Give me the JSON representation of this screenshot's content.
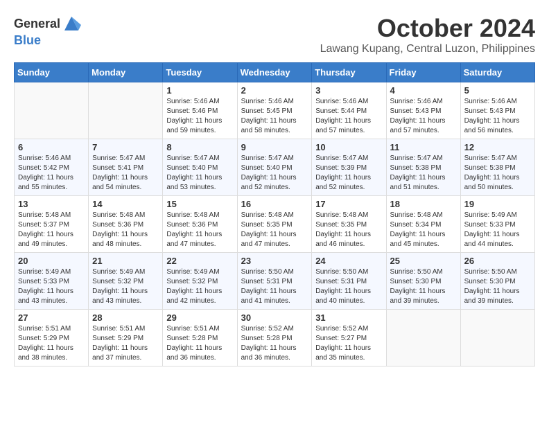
{
  "header": {
    "logo_general": "General",
    "logo_blue": "Blue",
    "month_title": "October 2024",
    "location": "Lawang Kupang, Central Luzon, Philippines"
  },
  "days_of_week": [
    "Sunday",
    "Monday",
    "Tuesday",
    "Wednesday",
    "Thursday",
    "Friday",
    "Saturday"
  ],
  "weeks": [
    [
      {
        "day": "",
        "info": ""
      },
      {
        "day": "",
        "info": ""
      },
      {
        "day": "1",
        "info": "Sunrise: 5:46 AM\nSunset: 5:46 PM\nDaylight: 11 hours and 59 minutes."
      },
      {
        "day": "2",
        "info": "Sunrise: 5:46 AM\nSunset: 5:45 PM\nDaylight: 11 hours and 58 minutes."
      },
      {
        "day": "3",
        "info": "Sunrise: 5:46 AM\nSunset: 5:44 PM\nDaylight: 11 hours and 57 minutes."
      },
      {
        "day": "4",
        "info": "Sunrise: 5:46 AM\nSunset: 5:43 PM\nDaylight: 11 hours and 57 minutes."
      },
      {
        "day": "5",
        "info": "Sunrise: 5:46 AM\nSunset: 5:43 PM\nDaylight: 11 hours and 56 minutes."
      }
    ],
    [
      {
        "day": "6",
        "info": "Sunrise: 5:46 AM\nSunset: 5:42 PM\nDaylight: 11 hours and 55 minutes."
      },
      {
        "day": "7",
        "info": "Sunrise: 5:47 AM\nSunset: 5:41 PM\nDaylight: 11 hours and 54 minutes."
      },
      {
        "day": "8",
        "info": "Sunrise: 5:47 AM\nSunset: 5:40 PM\nDaylight: 11 hours and 53 minutes."
      },
      {
        "day": "9",
        "info": "Sunrise: 5:47 AM\nSunset: 5:40 PM\nDaylight: 11 hours and 52 minutes."
      },
      {
        "day": "10",
        "info": "Sunrise: 5:47 AM\nSunset: 5:39 PM\nDaylight: 11 hours and 52 minutes."
      },
      {
        "day": "11",
        "info": "Sunrise: 5:47 AM\nSunset: 5:38 PM\nDaylight: 11 hours and 51 minutes."
      },
      {
        "day": "12",
        "info": "Sunrise: 5:47 AM\nSunset: 5:38 PM\nDaylight: 11 hours and 50 minutes."
      }
    ],
    [
      {
        "day": "13",
        "info": "Sunrise: 5:48 AM\nSunset: 5:37 PM\nDaylight: 11 hours and 49 minutes."
      },
      {
        "day": "14",
        "info": "Sunrise: 5:48 AM\nSunset: 5:36 PM\nDaylight: 11 hours and 48 minutes."
      },
      {
        "day": "15",
        "info": "Sunrise: 5:48 AM\nSunset: 5:36 PM\nDaylight: 11 hours and 47 minutes."
      },
      {
        "day": "16",
        "info": "Sunrise: 5:48 AM\nSunset: 5:35 PM\nDaylight: 11 hours and 47 minutes."
      },
      {
        "day": "17",
        "info": "Sunrise: 5:48 AM\nSunset: 5:35 PM\nDaylight: 11 hours and 46 minutes."
      },
      {
        "day": "18",
        "info": "Sunrise: 5:48 AM\nSunset: 5:34 PM\nDaylight: 11 hours and 45 minutes."
      },
      {
        "day": "19",
        "info": "Sunrise: 5:49 AM\nSunset: 5:33 PM\nDaylight: 11 hours and 44 minutes."
      }
    ],
    [
      {
        "day": "20",
        "info": "Sunrise: 5:49 AM\nSunset: 5:33 PM\nDaylight: 11 hours and 43 minutes."
      },
      {
        "day": "21",
        "info": "Sunrise: 5:49 AM\nSunset: 5:32 PM\nDaylight: 11 hours and 43 minutes."
      },
      {
        "day": "22",
        "info": "Sunrise: 5:49 AM\nSunset: 5:32 PM\nDaylight: 11 hours and 42 minutes."
      },
      {
        "day": "23",
        "info": "Sunrise: 5:50 AM\nSunset: 5:31 PM\nDaylight: 11 hours and 41 minutes."
      },
      {
        "day": "24",
        "info": "Sunrise: 5:50 AM\nSunset: 5:31 PM\nDaylight: 11 hours and 40 minutes."
      },
      {
        "day": "25",
        "info": "Sunrise: 5:50 AM\nSunset: 5:30 PM\nDaylight: 11 hours and 39 minutes."
      },
      {
        "day": "26",
        "info": "Sunrise: 5:50 AM\nSunset: 5:30 PM\nDaylight: 11 hours and 39 minutes."
      }
    ],
    [
      {
        "day": "27",
        "info": "Sunrise: 5:51 AM\nSunset: 5:29 PM\nDaylight: 11 hours and 38 minutes."
      },
      {
        "day": "28",
        "info": "Sunrise: 5:51 AM\nSunset: 5:29 PM\nDaylight: 11 hours and 37 minutes."
      },
      {
        "day": "29",
        "info": "Sunrise: 5:51 AM\nSunset: 5:28 PM\nDaylight: 11 hours and 36 minutes."
      },
      {
        "day": "30",
        "info": "Sunrise: 5:52 AM\nSunset: 5:28 PM\nDaylight: 11 hours and 36 minutes."
      },
      {
        "day": "31",
        "info": "Sunrise: 5:52 AM\nSunset: 5:27 PM\nDaylight: 11 hours and 35 minutes."
      },
      {
        "day": "",
        "info": ""
      },
      {
        "day": "",
        "info": ""
      }
    ]
  ]
}
